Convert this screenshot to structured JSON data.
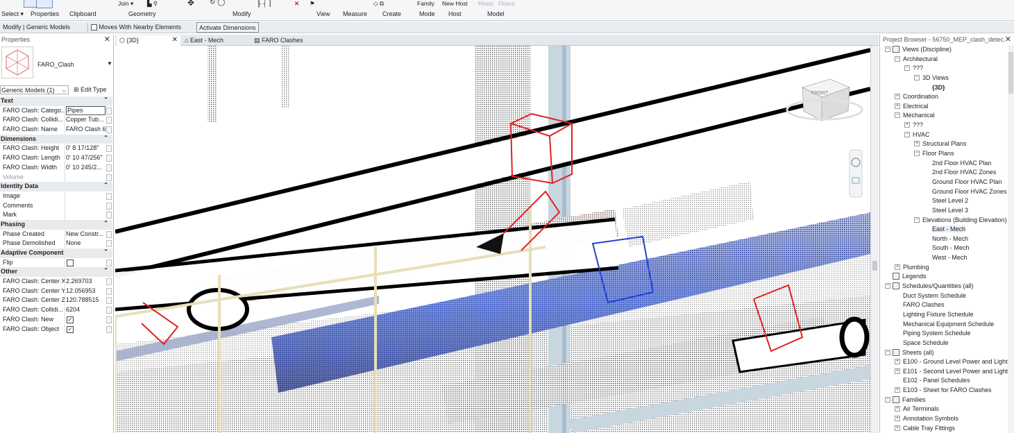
{
  "ribbon": {
    "groups": [
      {
        "id": "select",
        "label": "Select ▾"
      },
      {
        "id": "properties",
        "label": "Properties"
      },
      {
        "id": "clipboard",
        "label": "Clipboard"
      },
      {
        "id": "geometry",
        "label": "Geometry"
      },
      {
        "id": "modify",
        "label": "Modify"
      },
      {
        "id": "view",
        "label": "View"
      },
      {
        "id": "measure",
        "label": "Measure"
      },
      {
        "id": "create",
        "label": "Create"
      },
      {
        "id": "mode",
        "label": "Mode"
      },
      {
        "id": "host",
        "label": "Host"
      },
      {
        "id": "model",
        "label": "Model"
      }
    ],
    "top_items": {
      "join": "Join ▾",
      "family": "Family",
      "new_host": "New Host",
      "hosts": "Hosts",
      "floors": "Floors"
    }
  },
  "options_bar": {
    "context": "Modify | Generic Models",
    "moves_with": "Moves With Nearby Elements",
    "activate": "Activate Dimensions"
  },
  "properties": {
    "title": "Properties",
    "close": "✕",
    "type_name": "FARO_Clash",
    "selector": "Generic Models (1)",
    "edit_type": "Edit Type",
    "rows": [
      {
        "kind": "group",
        "label": "Text"
      },
      {
        "kind": "row",
        "key": "FARO Clash: Catego...",
        "value": "Pipes",
        "edit": true
      },
      {
        "kind": "row",
        "key": "FARO Clash: Collidi...",
        "value": "Copper Tub..."
      },
      {
        "kind": "row",
        "key": "FARO Clash: Name",
        "value": "FARO Clash 6"
      },
      {
        "kind": "group",
        "label": "Dimensions"
      },
      {
        "kind": "row",
        "key": "FARO Clash: Height",
        "value": "0'  8 17/128\""
      },
      {
        "kind": "row",
        "key": "FARO Clash: Length",
        "value": "0'  10 47/256\""
      },
      {
        "kind": "row",
        "key": "FARO Clash: Width",
        "value": "0'  10 245/2..."
      },
      {
        "kind": "row",
        "key": "Volume",
        "value": "",
        "muted": true
      },
      {
        "kind": "group",
        "label": "Identity Data"
      },
      {
        "kind": "row",
        "key": "Image",
        "value": ""
      },
      {
        "kind": "row",
        "key": "Comments",
        "value": ""
      },
      {
        "kind": "row",
        "key": "Mark",
        "value": ""
      },
      {
        "kind": "group",
        "label": "Phasing"
      },
      {
        "kind": "row",
        "key": "Phase Created",
        "value": "New Constr..."
      },
      {
        "kind": "row",
        "key": "Phase Demolished",
        "value": "None"
      },
      {
        "kind": "group",
        "label": "Adaptive Component"
      },
      {
        "kind": "row",
        "key": "Flip",
        "value": "",
        "check": "empty"
      },
      {
        "kind": "group",
        "label": "Other"
      },
      {
        "kind": "row",
        "key": "FARO Clash: Center X",
        "value": "2.269703"
      },
      {
        "kind": "row",
        "key": "FARO Clash: Center Y",
        "value": "12.056953"
      },
      {
        "kind": "row",
        "key": "FARO Clash: Center Z",
        "value": "120.788515"
      },
      {
        "kind": "row",
        "key": "FARO Clash: Collidi...",
        "value": "6204"
      },
      {
        "kind": "row",
        "key": "FARO Clash: New",
        "value": "",
        "check": "checked"
      },
      {
        "kind": "row",
        "key": "FARO Clash: Object",
        "value": "",
        "check": "checked"
      }
    ]
  },
  "view_tabs": [
    {
      "label": "{3D}",
      "active": true,
      "close": "✕",
      "icon": "3d-view-icon"
    },
    {
      "label": "East - Mech",
      "active": false,
      "icon": "elevation-icon"
    },
    {
      "label": "FARO Clashes",
      "active": false,
      "icon": "schedule-icon"
    }
  ],
  "viewcube": {
    "label": "FRONT"
  },
  "browser": {
    "title": "Project Browser - 56750_MEP_clash_detec...",
    "close": "✕",
    "nodes": [
      {
        "d": 0,
        "t": "-",
        "label": "Views (Discipline)",
        "icon": true
      },
      {
        "d": 1,
        "t": "-",
        "label": "Architectural"
      },
      {
        "d": 2,
        "t": "-",
        "label": "???"
      },
      {
        "d": 3,
        "t": "-",
        "label": "3D Views"
      },
      {
        "d": 4,
        "t": "",
        "label": "{3D}",
        "bold": true
      },
      {
        "d": 1,
        "t": "+",
        "label": "Coordination"
      },
      {
        "d": 1,
        "t": "+",
        "label": "Electrical"
      },
      {
        "d": 1,
        "t": "-",
        "label": "Mechanical"
      },
      {
        "d": 2,
        "t": "+",
        "label": "???"
      },
      {
        "d": 2,
        "t": "-",
        "label": "HVAC"
      },
      {
        "d": 3,
        "t": "+",
        "label": "Structural Plans"
      },
      {
        "d": 3,
        "t": "-",
        "label": "Floor Plans"
      },
      {
        "d": 4,
        "t": "",
        "label": "2nd Floor HVAC Plan"
      },
      {
        "d": 4,
        "t": "",
        "label": "2nd Floor HVAC Zones"
      },
      {
        "d": 4,
        "t": "",
        "label": "Ground Floor HVAC Plan"
      },
      {
        "d": 4,
        "t": "",
        "label": "Ground Floor HVAC Zones"
      },
      {
        "d": 4,
        "t": "",
        "label": "Steel Level 2"
      },
      {
        "d": 4,
        "t": "",
        "label": "Steel Level 3"
      },
      {
        "d": 3,
        "t": "-",
        "label": "Elevations (Building Elevation)"
      },
      {
        "d": 4,
        "t": "",
        "label": "East - Mech",
        "selected": true
      },
      {
        "d": 4,
        "t": "",
        "label": "North - Mech"
      },
      {
        "d": 4,
        "t": "",
        "label": "South - Mech"
      },
      {
        "d": 4,
        "t": "",
        "label": "West - Mech"
      },
      {
        "d": 1,
        "t": "+",
        "label": "Plumbing"
      },
      {
        "d": 0,
        "t": "",
        "label": "Legends",
        "icon": true
      },
      {
        "d": 0,
        "t": "-",
        "label": "Schedules/Quantities (all)",
        "icon": true
      },
      {
        "d": 1,
        "t": "",
        "label": "Duct System Schedule"
      },
      {
        "d": 1,
        "t": "",
        "label": "FARO Clashes"
      },
      {
        "d": 1,
        "t": "",
        "label": "Lighting Fixture Schedule"
      },
      {
        "d": 1,
        "t": "",
        "label": "Mechanical Equipment Schedule"
      },
      {
        "d": 1,
        "t": "",
        "label": "Piping System Schedule"
      },
      {
        "d": 1,
        "t": "",
        "label": "Space Schedule"
      },
      {
        "d": 0,
        "t": "-",
        "label": "Sheets (all)",
        "icon": true
      },
      {
        "d": 1,
        "t": "+",
        "label": "E100 - Ground Level Power and Lighting"
      },
      {
        "d": 1,
        "t": "+",
        "label": "E101 - Second Level Power and Lighting"
      },
      {
        "d": 1,
        "t": "",
        "label": "E102 - Panel Schedules"
      },
      {
        "d": 1,
        "t": "+",
        "label": "E103 - Sheet for FARO Clashes"
      },
      {
        "d": 0,
        "t": "-",
        "label": "Families",
        "icon": true
      },
      {
        "d": 1,
        "t": "+",
        "label": "Air Terminals"
      },
      {
        "d": 1,
        "t": "+",
        "label": "Annotation Symbols"
      },
      {
        "d": 1,
        "t": "+",
        "label": "Cable Tray Fittings"
      }
    ]
  }
}
